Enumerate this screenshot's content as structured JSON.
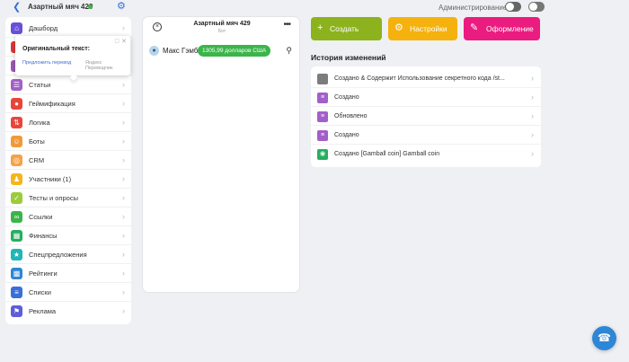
{
  "header": {
    "back_icon": "chevron-left-icon",
    "title": "Азартный мяч 429",
    "status_color": "#42b34a",
    "settings_icon": "gear-icon",
    "admin_label": "Администрирование"
  },
  "sidebar": {
    "items": [
      {
        "label": "Дашборд",
        "icon": "home-icon",
        "color": "#6a4fd8"
      },
      {
        "label": "",
        "icon": "sidebar-icon",
        "color": "#e03636"
      },
      {
        "label": "",
        "icon": "sidebar-icon",
        "color": "#9b59b6"
      },
      {
        "label": "Статьи",
        "icon": "layers-icon",
        "color": "#a35fc9"
      },
      {
        "label": "Геймификация",
        "icon": "gamepad-icon",
        "color": "#e8463b"
      },
      {
        "label": "Логика",
        "icon": "flow-icon",
        "color": "#e8463b"
      },
      {
        "label": "Боты",
        "icon": "bot-icon",
        "color": "#f19a3a"
      },
      {
        "label": "CRM",
        "icon": "target-icon",
        "color": "#f4a24a"
      },
      {
        "label": "Участники (1)",
        "icon": "users-icon",
        "color": "#f5b61b"
      },
      {
        "label": "Тесты и опросы",
        "icon": "checklist-icon",
        "color": "#9ccc3a"
      },
      {
        "label": "Ссылки",
        "icon": "link-icon",
        "color": "#3bb54a"
      },
      {
        "label": "Финансы",
        "icon": "finance-icon",
        "color": "#27ae60"
      },
      {
        "label": "Спецпредложения",
        "icon": "star-icon",
        "color": "#1fb6b6"
      },
      {
        "label": "Рейтинги",
        "icon": "chart-icon",
        "color": "#2e86d6"
      },
      {
        "label": "Списки",
        "icon": "list-icon",
        "color": "#3a6fd8"
      },
      {
        "label": "Реклама",
        "icon": "flag-icon",
        "color": "#5b5fd8"
      }
    ]
  },
  "popup": {
    "title": "Оригинальный текст:",
    "link": "Предложить перевод",
    "provider": "Яндекс Переводчик"
  },
  "phone": {
    "title": "Азартный мяч 429",
    "subtitle": "Бот",
    "avatar_icon": "avatar-icon",
    "user": "Макс Гэмб",
    "balance": "1305,99 долларов США",
    "balance_color": "#3bb54a"
  },
  "actions": {
    "create": {
      "label": "Создать",
      "icon": "plus-icon",
      "color": "#8cb21d"
    },
    "settings": {
      "label": "Настройки",
      "icon": "gear-icon",
      "color": "#f5b10d"
    },
    "design": {
      "label": "Оформление",
      "icon": "brush-icon",
      "color": "#eb1c7f"
    }
  },
  "history": {
    "title": "История изменений",
    "rows": [
      {
        "text": "Создано & Содержит Использование секретного кода /st...",
        "icon": "block-icon",
        "color": "#7c7c7c"
      },
      {
        "text": "Создано",
        "icon": "article-icon",
        "color": "#a35fc9"
      },
      {
        "text": "Обновлено",
        "icon": "article-icon",
        "color": "#a35fc9"
      },
      {
        "text": "Создано",
        "icon": "article-icon",
        "color": "#a35fc9"
      },
      {
        "text": "Создано [Gamball coin] Gamball coin",
        "icon": "coin-icon",
        "color": "#27ae60"
      }
    ]
  },
  "support": {
    "icon": "headset-icon",
    "color": "#2e86d6"
  }
}
